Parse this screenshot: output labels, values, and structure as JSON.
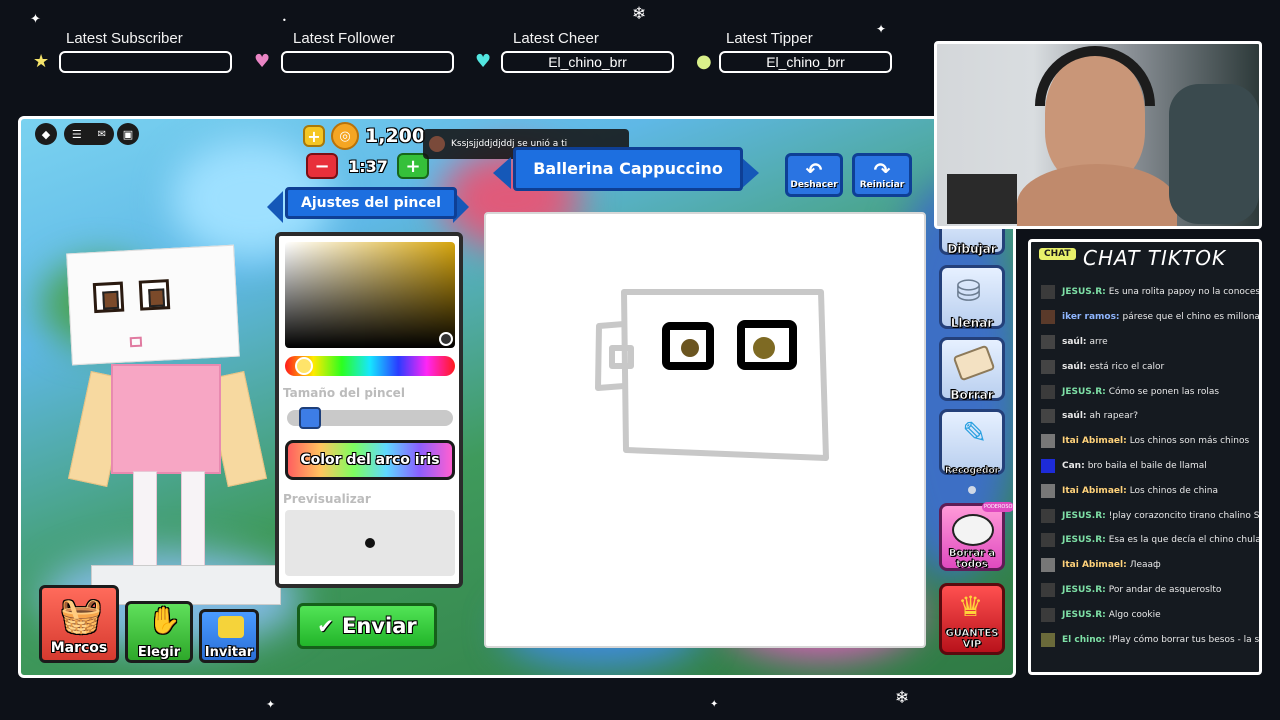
{
  "alerts": {
    "subscriber": {
      "label": "Latest Subscriber",
      "value": ""
    },
    "follower": {
      "label": "Latest Follower",
      "value": ""
    },
    "cheer": {
      "label": "Latest Cheer",
      "value": "El_chino_brr"
    },
    "tipper": {
      "label": "Latest Tipper",
      "value": "El_chino_brr"
    }
  },
  "game": {
    "coins": "1,200",
    "timer": "1:37",
    "word": "Ballerina Cappuccino",
    "toast": "Kssjsjjddjdjddj se unió a ti",
    "undo_label": "Deshacer",
    "reset_label": "Reiniciar",
    "brush_settings_title": "Ajustes del pincel",
    "brush_size_label": "Tamaño del pincel",
    "brush_size_fraction": 0.08,
    "rainbow_button": "Color del arco iris",
    "preview_label": "Previsualizar",
    "send_button": "Enviar",
    "tools": [
      {
        "label": "Dibujar",
        "icon": "pencil-icon"
      },
      {
        "label": "Llenar",
        "icon": "paint-bucket-icon"
      },
      {
        "label": "Borrar",
        "icon": "eraser-icon"
      },
      {
        "label": "Recogedor",
        "icon": "eyedropper-icon"
      }
    ],
    "erase_all_label": "Borrar a todos",
    "erase_all_badge": "PODEROSO",
    "vip_label": "GUANTES VIP",
    "bottom_buttons": {
      "frames": "Marcos",
      "choose": "Elegir",
      "invite": "Invitar"
    }
  },
  "chat": {
    "badge": "CHAT",
    "title": "CHAT TIKTOK",
    "messages": [
      {
        "user": "JESUS.R:",
        "text": "Es una rolita papoy no la conoces ?",
        "color": "#7ee0a6"
      },
      {
        "user": "iker ramos:",
        "text": "párese que el chino es millonario",
        "color": "#8fb6ff"
      },
      {
        "user": "saúl:",
        "text": "arre",
        "color": "#e8e8e8"
      },
      {
        "user": "saúl:",
        "text": "está rico el calor",
        "color": "#e8e8e8"
      },
      {
        "user": "JESUS.R:",
        "text": "Cómo se ponen las rolas",
        "color": "#7ee0a6"
      },
      {
        "user": "saúl:",
        "text": "ah rapear?",
        "color": "#e8e8e8"
      },
      {
        "user": "Itai Abimael:",
        "text": "Los chinos son más chinos",
        "color": "#ffd27a"
      },
      {
        "user": "Can:",
        "text": "bro baila el baile de llamal",
        "color": "#e8e8e8"
      },
      {
        "user": "Itai Abimael:",
        "text": "Los chinos de china",
        "color": "#ffd27a"
      },
      {
        "user": "JESUS.R:",
        "text": "!play corazoncito tirano chalino Sánchez",
        "color": "#7ee0a6"
      },
      {
        "user": "JESUS.R:",
        "text": "Esa es la que decía el chino chulada",
        "color": "#7ee0a6"
      },
      {
        "user": "Itai Abimael:",
        "text": "Леааф",
        "color": "#ffd27a"
      },
      {
        "user": "JESUS.R:",
        "text": "Por andar de asqueroslto",
        "color": "#7ee0a6"
      },
      {
        "user": "JESUS.R:",
        "text": "Algo cookie",
        "color": "#7ee0a6"
      },
      {
        "user": "El chino:",
        "text": "!Play cómo borrar tus besos - la sampe",
        "color": "#7ee0a6"
      }
    ]
  },
  "colors": {
    "accent_blue": "#1d6fe0",
    "send_green": "#2fcf3a",
    "minus_red": "#e8303a",
    "plus_green": "#35c03a"
  }
}
